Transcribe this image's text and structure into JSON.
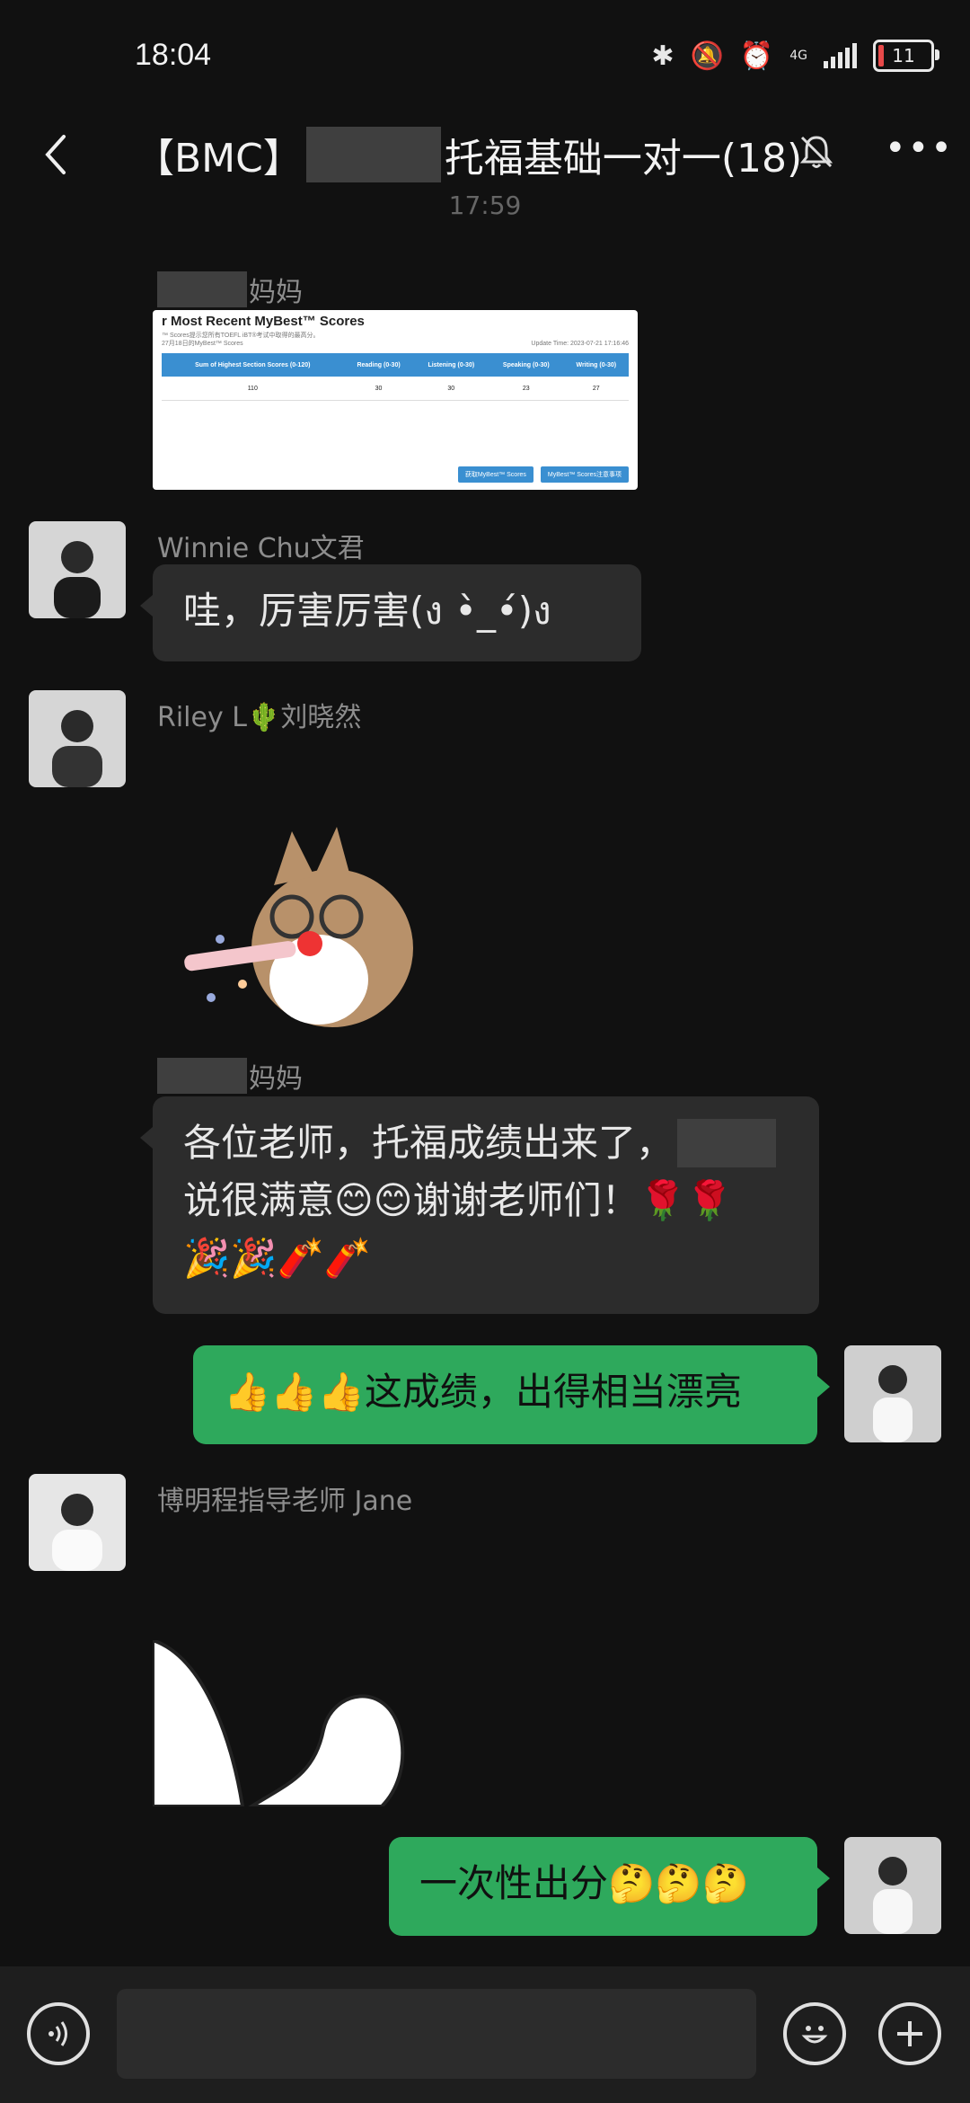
{
  "status_bar": {
    "time": "18:04",
    "network": "4G",
    "battery": "11"
  },
  "header": {
    "title_prefix": "【BMC】",
    "title_suffix": "托福基础一对一(18)"
  },
  "timestamp": "17:59",
  "messages": [
    {
      "sender_suffix": "妈妈",
      "type": "image",
      "card": {
        "heading": "r Most Recent MyBest™ Scores",
        "sub1": "™ Scores提示您所有TOEFL iBT®考试中取得的最高分。",
        "sub2": "27月18日的MyBest™ Scores",
        "update": "Update Time: 2023-07-21 17:16:46",
        "headers": [
          "Sum of Highest Section Scores (0-120)",
          "Reading (0-30)",
          "Listening (0-30)",
          "Speaking (0-30)",
          "Writing (0-30)"
        ],
        "values": [
          "110",
          "30",
          "30",
          "23",
          "27"
        ],
        "btn1": "获取MyBest™ Scores",
        "btn2": "MyBest™ Scores注意事项"
      }
    },
    {
      "sender": "Winnie Chu文君",
      "text": "哇，厉害厉害(ง •̀_•́)ง"
    },
    {
      "sender": "Riley L🌵刘晓然",
      "type": "sticker"
    },
    {
      "sender_suffix": "妈妈",
      "text_line1": "各位老师，托福成绩出来了，",
      "text_line2": "说很满意😊😊谢谢老师们！🌹🌹",
      "text_line3": "🎉🎉🧨🧨"
    },
    {
      "self": true,
      "text": "👍👍👍这成绩，出得相当漂亮"
    },
    {
      "sender": "博明程指导老师 Jane",
      "type": "sticker"
    },
    {
      "self": true,
      "text": "一次性出分🤔🤔🤔"
    }
  ],
  "icons": [
    "back-icon",
    "mute-icon",
    "more-icon",
    "voice-icon",
    "emoji-icon",
    "plus-icon"
  ]
}
